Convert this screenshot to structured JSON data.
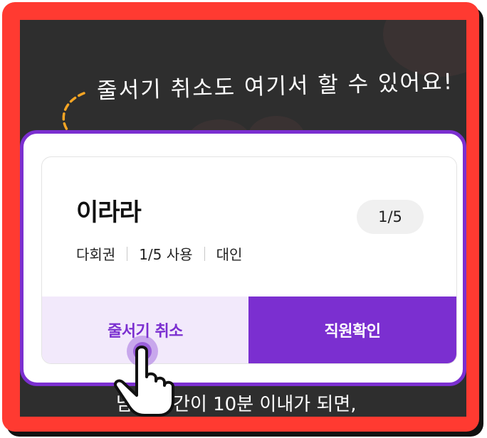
{
  "annotation": {
    "hint_text": "줄서기 취소도 여기서 할 수 있어요!"
  },
  "ticket": {
    "name": "이라라",
    "count_badge": "1/5",
    "meta": [
      "다회권",
      "1/5 사용",
      "대인"
    ]
  },
  "actions": {
    "cancel_label": "줄서기 취소",
    "confirm_label": "직원확인"
  },
  "background_text": {
    "line1": "남은 시간이 10분 이내가 되면,"
  },
  "colors": {
    "frame": "#ff3a31",
    "accent": "#7b2fd0",
    "accent_light": "#f2e9fb",
    "arrow": "#f5a524",
    "overlay": "#2e2e2e"
  },
  "icons": [
    "dashed-arrow-icon",
    "pointing-hand-icon"
  ]
}
